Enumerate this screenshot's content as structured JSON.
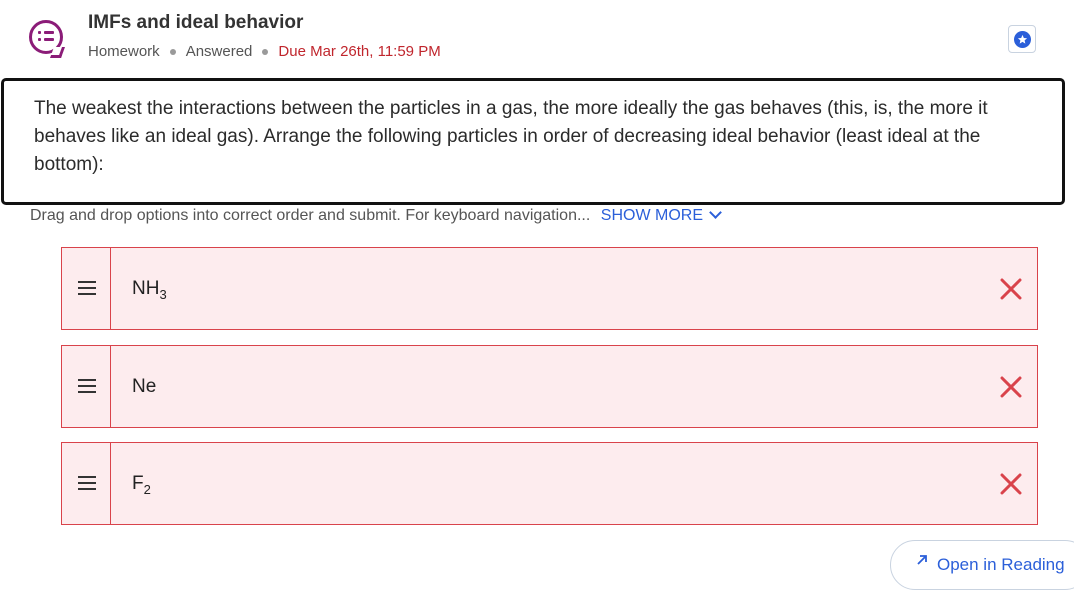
{
  "assignment": {
    "title": "IMFs and ideal behavior",
    "type": "Homework",
    "status": "Answered",
    "due": "Due Mar 26th, 11:59 PM"
  },
  "question": {
    "text": "The weakest the interactions between the particles in a gas, the more ideally the gas behaves (this, is, the more it behaves like an ideal gas). Arrange the following particles in order of decreasing ideal behavior (least ideal at the bottom):"
  },
  "instructions": {
    "text": "Drag and drop options into correct order and submit. For keyboard navigation...",
    "show_more": "SHOW MORE"
  },
  "options": [
    {
      "base": "NH",
      "sub": "3",
      "state": "incorrect"
    },
    {
      "base": "Ne",
      "sub": "",
      "state": "incorrect"
    },
    {
      "base": "F",
      "sub": "2",
      "state": "incorrect"
    }
  ],
  "footer": {
    "open_reading": "Open in Reading"
  },
  "colors": {
    "accent": "#2b5fd9",
    "question_icon": "#8b1c78",
    "error": "#d9434b",
    "error_bg": "#fdecee",
    "due": "#c0262d"
  },
  "icons": {
    "question": "question-list-icon",
    "star": "star-icon",
    "handle": "drag-handle-icon",
    "incorrect": "close-icon",
    "external": "open-external-icon"
  }
}
